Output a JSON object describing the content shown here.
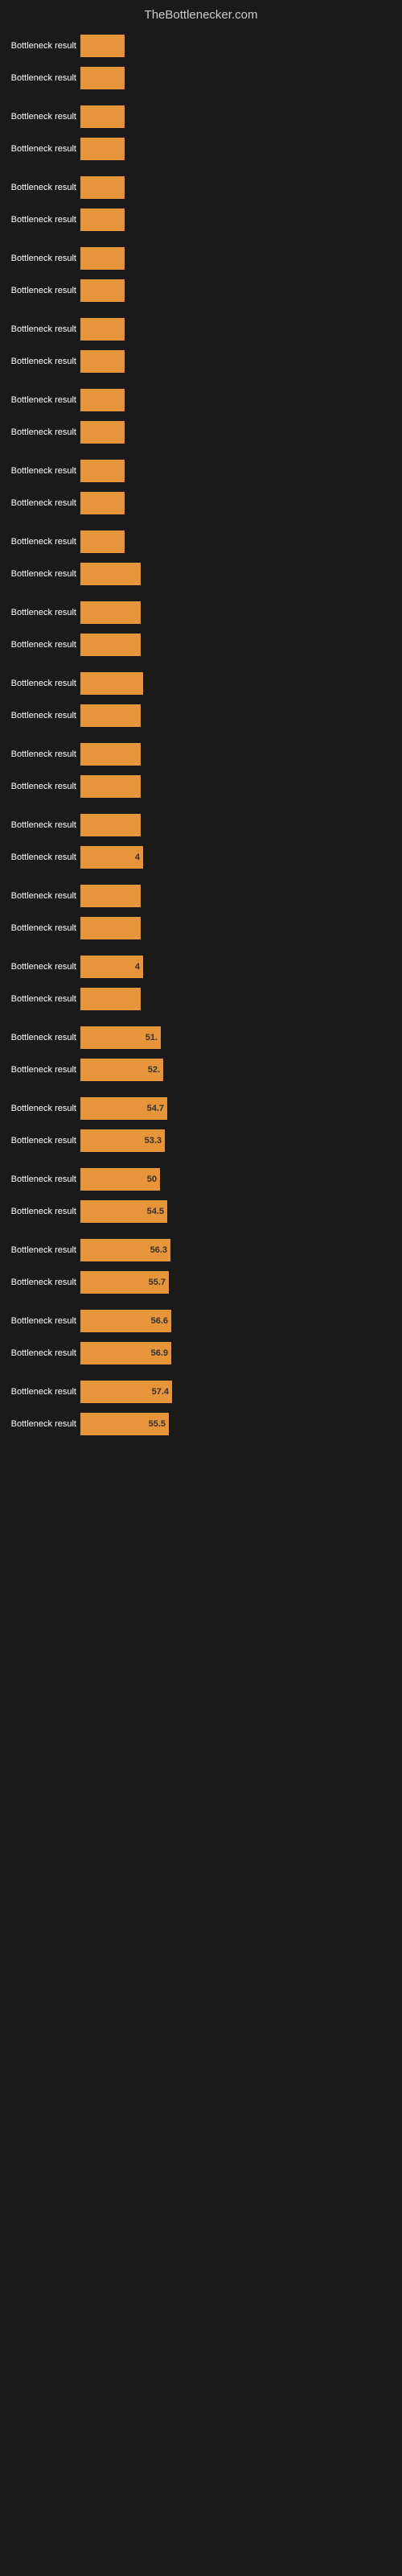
{
  "header": {
    "title": "TheBottlenecker.com"
  },
  "bars": [
    {
      "label": "Bottleneck result",
      "value": null,
      "width": 55,
      "display": ""
    },
    {
      "label": "Bottleneck result",
      "value": null,
      "width": 55,
      "display": ""
    },
    {
      "label": "Bottleneck result",
      "value": null,
      "width": 55,
      "display": ""
    },
    {
      "label": "Bottleneck result",
      "value": null,
      "width": 55,
      "display": ""
    },
    {
      "label": "Bottleneck result",
      "value": null,
      "width": 55,
      "display": ""
    },
    {
      "label": "Bottleneck result",
      "value": null,
      "width": 55,
      "display": ""
    },
    {
      "label": "Bottleneck result",
      "value": null,
      "width": 55,
      "display": ""
    },
    {
      "label": "Bottleneck result",
      "value": null,
      "width": 55,
      "display": ""
    },
    {
      "label": "Bottleneck result",
      "value": null,
      "width": 55,
      "display": ""
    },
    {
      "label": "Bottleneck result",
      "value": null,
      "width": 55,
      "display": ""
    },
    {
      "label": "Bottleneck result",
      "value": null,
      "width": 55,
      "display": ""
    },
    {
      "label": "Bottleneck result",
      "value": null,
      "width": 55,
      "display": ""
    },
    {
      "label": "Bottleneck result",
      "value": null,
      "width": 55,
      "display": ""
    },
    {
      "label": "Bottleneck result",
      "value": null,
      "width": 55,
      "display": ""
    },
    {
      "label": "Bottleneck result",
      "value": null,
      "width": 55,
      "display": ""
    },
    {
      "label": "Bottleneck result",
      "value": null,
      "width": 75,
      "display": ""
    },
    {
      "label": "Bottleneck result",
      "value": null,
      "width": 75,
      "display": ""
    },
    {
      "label": "Bottleneck result",
      "value": null,
      "width": 75,
      "display": ""
    },
    {
      "label": "Bottleneck result",
      "value": null,
      "width": 78,
      "display": ""
    },
    {
      "label": "Bottleneck result",
      "value": null,
      "width": 75,
      "display": ""
    },
    {
      "label": "Bottleneck result",
      "value": null,
      "width": 75,
      "display": ""
    },
    {
      "label": "Bottleneck result",
      "value": null,
      "width": 75,
      "display": ""
    },
    {
      "label": "Bottleneck result",
      "value": null,
      "width": 75,
      "display": ""
    },
    {
      "label": "Bottleneck result",
      "value": null,
      "width": 78,
      "display": "4"
    },
    {
      "label": "Bottleneck result",
      "value": null,
      "width": 75,
      "display": ""
    },
    {
      "label": "Bottleneck result",
      "value": null,
      "width": 75,
      "display": ""
    },
    {
      "label": "Bottleneck result",
      "value": null,
      "width": 78,
      "display": "4"
    },
    {
      "label": "Bottleneck result",
      "value": null,
      "width": 75,
      "display": ""
    },
    {
      "label": "Bottleneck result",
      "value": 51,
      "width": 100,
      "display": "51."
    },
    {
      "label": "Bottleneck result",
      "value": 52,
      "width": 103,
      "display": "52."
    },
    {
      "label": "Bottleneck result",
      "value": 54.7,
      "width": 108,
      "display": "54.7"
    },
    {
      "label": "Bottleneck result",
      "value": 53.3,
      "width": 105,
      "display": "53.3"
    },
    {
      "label": "Bottleneck result",
      "value": 50,
      "width": 99,
      "display": "50"
    },
    {
      "label": "Bottleneck result",
      "value": 54.5,
      "width": 108,
      "display": "54.5"
    },
    {
      "label": "Bottleneck result",
      "value": 56.3,
      "width": 112,
      "display": "56.3"
    },
    {
      "label": "Bottleneck result",
      "value": 55.7,
      "width": 110,
      "display": "55.7"
    },
    {
      "label": "Bottleneck result",
      "value": 56.6,
      "width": 113,
      "display": "56.6"
    },
    {
      "label": "Bottleneck result",
      "value": 56.9,
      "width": 113,
      "display": "56.9"
    },
    {
      "label": "Bottleneck result",
      "value": 57.4,
      "width": 114,
      "display": "57.4"
    },
    {
      "label": "Bottleneck result",
      "value": 55.5,
      "width": 110,
      "display": "55.5"
    }
  ]
}
